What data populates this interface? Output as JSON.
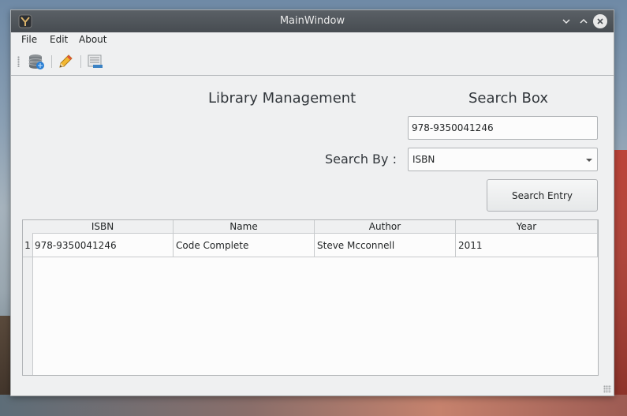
{
  "window": {
    "title": "MainWindow"
  },
  "menu": {
    "file": "File",
    "edit": "Edit",
    "about": "About"
  },
  "toolbar": {
    "items": [
      {
        "icon": "database-icon"
      },
      {
        "icon": "pencil-icon"
      },
      {
        "icon": "document-list-icon"
      }
    ]
  },
  "main": {
    "title": "Library Management",
    "search_title": "Search Box",
    "search_value": "978-9350041246",
    "search_by_label": "Search By :",
    "search_by_selected": "ISBN",
    "search_button": "Search Entry"
  },
  "table": {
    "columns": [
      "ISBN",
      "Name",
      "Author",
      "Year"
    ],
    "rows": [
      {
        "num": "1",
        "isbn": "978-9350041246",
        "name": "Code Complete",
        "author": "Steve Mcconnell",
        "year": "2011"
      }
    ]
  },
  "colors": {
    "titlebar": "#4d5257",
    "window_bg": "#eff0f1",
    "accent": "#3daee9"
  }
}
